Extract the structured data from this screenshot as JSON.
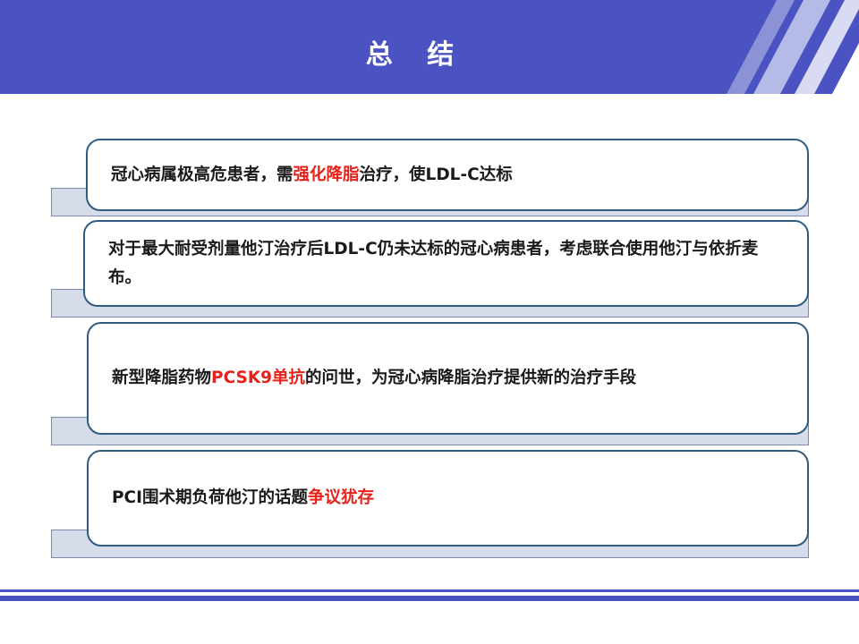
{
  "header": {
    "title": "总 结",
    "color": "#4a53c1"
  },
  "accent_colors": {
    "highlight": "#e8211b",
    "card_border": "#2f5c80",
    "card_shadow": "#d6dcea"
  },
  "cards": [
    {
      "segments": [
        {
          "text": "冠心病属极高危患者，需",
          "highlight": false
        },
        {
          "text": "强化降脂",
          "highlight": true
        },
        {
          "text": "治疗，使LDL-C达标",
          "highlight": false
        }
      ]
    },
    {
      "segments": [
        {
          "text": "对于最大耐受剂量他汀治疗后LDL-C仍未达标的冠心病患者，考虑联合使用他汀与依折麦布。",
          "highlight": false
        }
      ]
    },
    {
      "segments": [
        {
          "text": "新型降脂药物",
          "highlight": false
        },
        {
          "text": "PCSK9单抗",
          "highlight": true
        },
        {
          "text": "的问世，为冠心病降脂治疗提供新的治疗手段",
          "highlight": false
        }
      ]
    },
    {
      "segments": [
        {
          "text": "PCI围术期负荷他汀的话题",
          "highlight": false
        },
        {
          "text": "争议犹存",
          "highlight": true
        }
      ]
    }
  ]
}
